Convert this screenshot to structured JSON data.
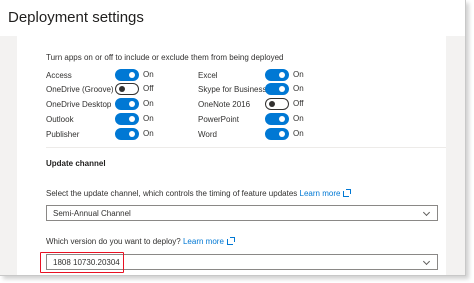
{
  "window": {
    "title": "Deployment settings"
  },
  "apps_section": {
    "intro": "Turn apps on or off to include or exclude them from being deployed",
    "left_column": [
      {
        "name": "Access",
        "state": "On",
        "on": true
      },
      {
        "name": "OneDrive (Groove)",
        "state": "Off",
        "on": false
      },
      {
        "name": "OneDrive Desktop",
        "state": "On",
        "on": true
      },
      {
        "name": "Outlook",
        "state": "On",
        "on": true
      },
      {
        "name": "Publisher",
        "state": "On",
        "on": true
      }
    ],
    "right_column": [
      {
        "name": "Excel",
        "state": "On",
        "on": true
      },
      {
        "name": "Skype for Business",
        "state": "On",
        "on": true
      },
      {
        "name": "OneNote 2016",
        "state": "Off",
        "on": false
      },
      {
        "name": "PowerPoint",
        "state": "On",
        "on": true
      },
      {
        "name": "Word",
        "state": "On",
        "on": true
      }
    ]
  },
  "update_channel": {
    "title": "Update channel",
    "description": "Select the update channel, which controls the timing of feature updates",
    "learn_more": "Learn more",
    "selected": "Semi-Annual Channel"
  },
  "version": {
    "question": "Which version do you want to deploy?",
    "learn_more": "Learn more",
    "selected": "1808 10730.20304"
  },
  "colors": {
    "accent": "#0078d4",
    "highlight": "#e81123"
  }
}
